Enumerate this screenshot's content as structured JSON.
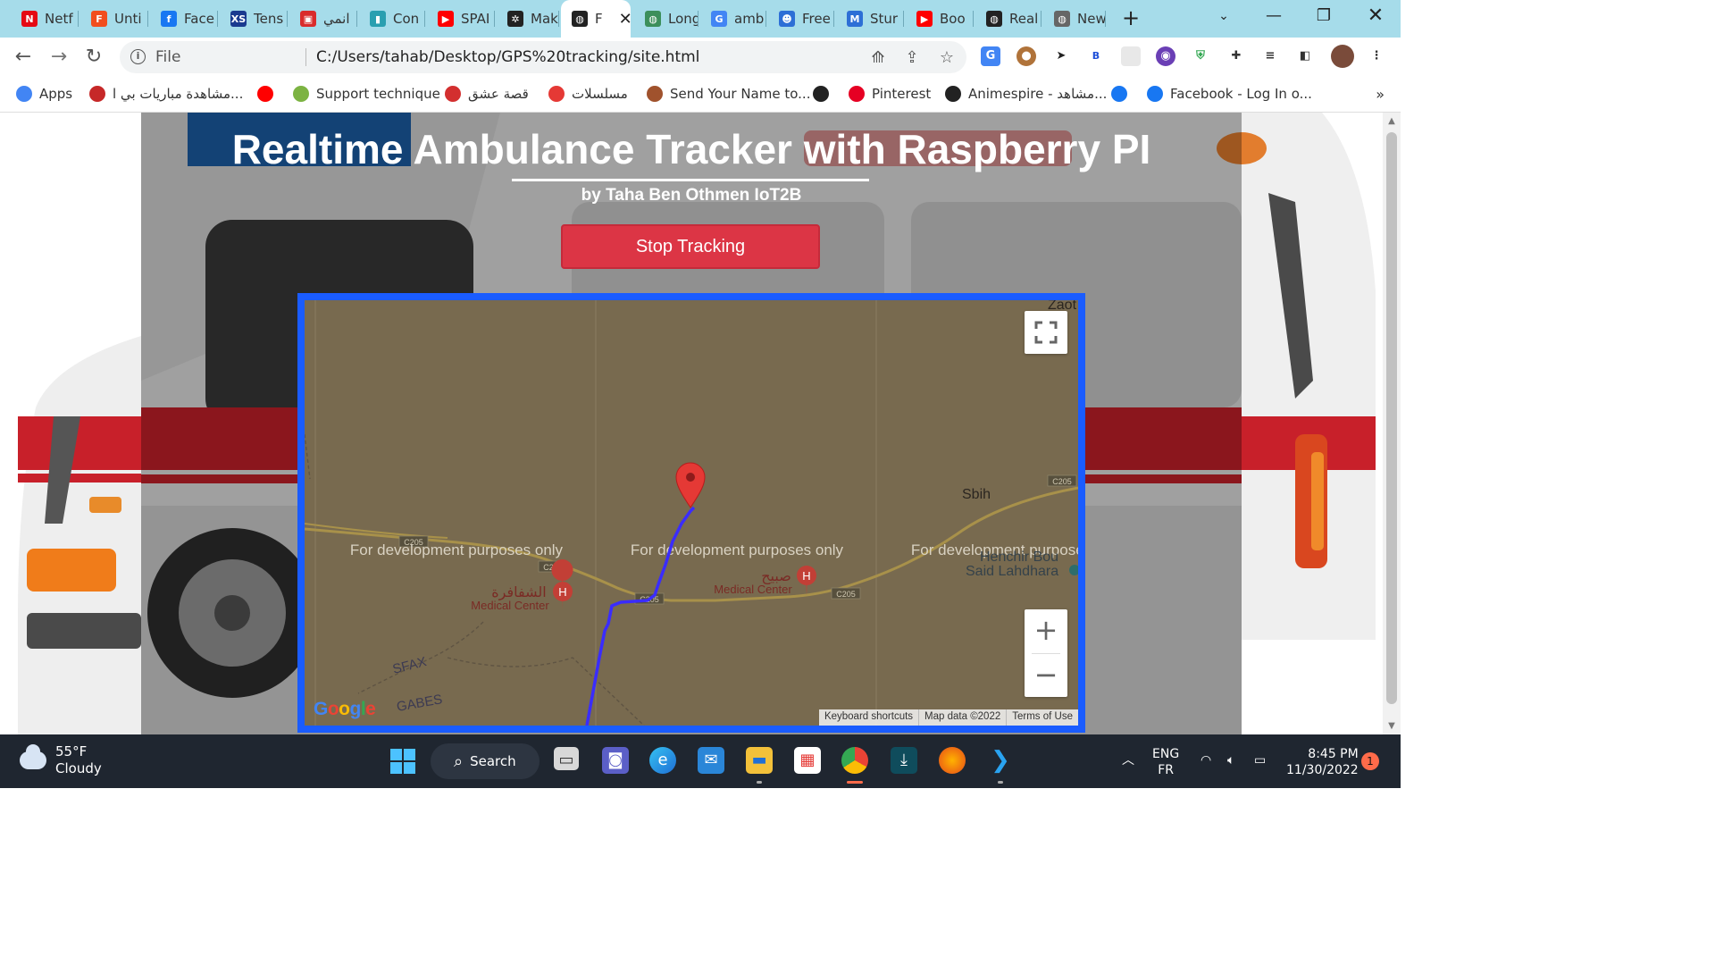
{
  "browser": {
    "tabs": [
      {
        "label": "Netf",
        "icon": "netflix-icon",
        "color": "#e50914",
        "glyph": "N"
      },
      {
        "label": "Unti",
        "icon": "figma-icon",
        "color": "#f24e1e",
        "glyph": "F"
      },
      {
        "label": "Face",
        "icon": "facebook-icon",
        "color": "#1877f2",
        "glyph": "f"
      },
      {
        "label": "Tens",
        "icon": "xs-icon",
        "color": "#1a3a8f",
        "glyph": "XS"
      },
      {
        "label": "انمي",
        "icon": "anime-site-icon",
        "color": "#d92b2b",
        "glyph": "▣"
      },
      {
        "label": "Con",
        "icon": "docs-icon",
        "color": "#2a9fb0",
        "glyph": "▮"
      },
      {
        "label": "SPAI",
        "icon": "youtube-icon",
        "color": "#ff0000",
        "glyph": "▶"
      },
      {
        "label": "Mak",
        "icon": "openai-icon",
        "color": "#222222",
        "glyph": "✲"
      },
      {
        "label": "F",
        "icon": "globe-icon",
        "color": "#222222",
        "glyph": "◍"
      },
      {
        "label": "Long",
        "icon": "globe-icon",
        "color": "#3c8f5b",
        "glyph": "◍"
      },
      {
        "label": "amb",
        "icon": "google-icon",
        "color": "#4285f4",
        "glyph": "G"
      },
      {
        "label": "Free",
        "icon": "robot-icon",
        "color": "#2d6fd6",
        "glyph": "☻"
      },
      {
        "label": "Stur",
        "icon": "msdn-icon",
        "color": "#2d6fd6",
        "glyph": "M"
      },
      {
        "label": "Boo",
        "icon": "youtube-icon",
        "color": "#ff0000",
        "glyph": "▶"
      },
      {
        "label": "Real",
        "icon": "globe-icon",
        "color": "#222222",
        "glyph": "◍"
      },
      {
        "label": "New",
        "icon": "chrome-icon",
        "color": "#666666",
        "glyph": "◍"
      }
    ],
    "url_scheme": "File",
    "url": "C:/Users/tahab/Desktop/GPS%20tracking/site.html",
    "bookmarks": [
      {
        "label": "Apps",
        "icon": "apps-grid-icon",
        "color": "#4285f4"
      },
      {
        "label": "مشاهدة مباريات بي ا...",
        "icon": "cimaclub-icon",
        "color": "#c62828"
      },
      {
        "label": "",
        "icon": "youtube-icon",
        "color": "#ff0000"
      },
      {
        "label": "Support technique",
        "icon": "support-icon",
        "color": "#7cb342"
      },
      {
        "label": "قصة عشق",
        "icon": "qissa-icon",
        "color": "#d32f2f"
      },
      {
        "label": "مسلسلات",
        "icon": "series-icon",
        "color": "#e53935"
      },
      {
        "label": "Send Your Name to...",
        "icon": "mars-icon",
        "color": "#a0522d"
      },
      {
        "label": "",
        "icon": "globe-icon",
        "color": "#222222"
      },
      {
        "label": "Pinterest",
        "icon": "pinterest-icon",
        "color": "#e60023"
      },
      {
        "label": "Animespire - مشاهد...",
        "icon": "globe-icon",
        "color": "#222222"
      },
      {
        "label": "",
        "icon": "facebook-icon",
        "color": "#1877f2"
      },
      {
        "label": "Facebook - Log In o...",
        "icon": "facebook-icon",
        "color": "#1877f2"
      }
    ],
    "overflow": "»"
  },
  "page": {
    "title": "Realtime Ambulance Tracker with Raspberry PI",
    "subtitle": "by Taha Ben Othmen IoT2B",
    "button": "Stop Tracking",
    "map": {
      "watermark": "For development purposes only",
      "labels": {
        "zaot": "Zaot",
        "sbih": "Sbih",
        "henchir": "Henchir Bou",
        "said": "Said Lahdhara",
        "shafara": "الشفافرة",
        "sbih_ar": "صبيح",
        "medical": "Medical Center",
        "sfax": "SFAX",
        "gabes": "GABES",
        "road": "C205"
      },
      "attribution": [
        "Keyboard shortcuts",
        "Map data ©2022",
        "Terms of Use"
      ],
      "google": "Google",
      "zoom_in": "+",
      "zoom_out": "−",
      "route_color": "#3a2cff",
      "marker_color": "#e53935"
    }
  },
  "taskbar": {
    "temperature": "55°F",
    "condition": "Cloudy",
    "search": "Search",
    "lang_top": "ENG",
    "lang_bottom": "FR",
    "time": "8:45 PM",
    "date": "11/30/2022",
    "notifications": "1"
  }
}
